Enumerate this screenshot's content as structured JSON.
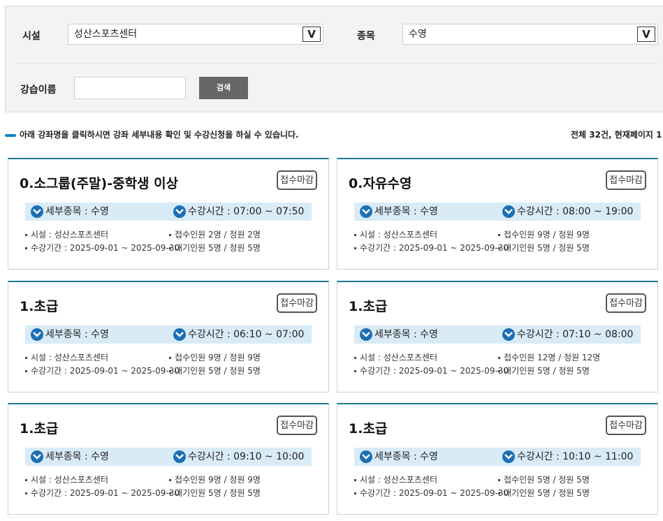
{
  "search": {
    "facility_label": "시설",
    "facility_value": "성산스포츠센터",
    "sport_label": "종목",
    "sport_value": "수영",
    "course_label": "강습이름",
    "course_value": "",
    "arrow_glyph": "V",
    "search_button": "검색"
  },
  "info": {
    "guide": "아래 강좌명을 클릭하시면 강좌 세부내용 확인 및 수강신청을 하실 수 있습니다.",
    "total": "전체 32건, 현재페이지 1"
  },
  "labels": {
    "sub_sport": "세부종목 : ",
    "time": "수강시간 : ",
    "facility": "시설 : ",
    "period": "수강기간 : "
  },
  "cards": [
    {
      "title": "0.소그룹(주말)-중학생 이상",
      "status": "접수마감",
      "sub_sport": "수영",
      "time": "07:00 ~ 07:50",
      "facility": "성산스포츠센터",
      "period": "2025-09-01 ~ 2025-09-30",
      "enrolled": "접수인원 2명 / 정원 2명",
      "waiting": "대기인원 5명 / 정원 5명"
    },
    {
      "title": "0.자유수영",
      "status": "접수마감",
      "sub_sport": "수영",
      "time": "08:00 ~ 19:00",
      "facility": "성산스포츠센터",
      "period": "2025-09-01 ~ 2025-09-30",
      "enrolled": "접수인원 9명 / 정원 9명",
      "waiting": "대기인원 5명 / 정원 5명"
    },
    {
      "title": "1.초급",
      "status": "접수마감",
      "sub_sport": "수영",
      "time": "06:10 ~ 07:00",
      "facility": "성산스포츠센터",
      "period": "2025-09-01 ~ 2025-09-30",
      "enrolled": "접수인원 9명 / 정원 9명",
      "waiting": "대기인원 5명 / 정원 5명"
    },
    {
      "title": "1.초급",
      "status": "접수마감",
      "sub_sport": "수영",
      "time": "07:10 ~ 08:00",
      "facility": "성산스포츠센터",
      "period": "2025-09-01 ~ 2025-09-30",
      "enrolled": "접수인원 12명 / 정원 12명",
      "waiting": "대기인원 5명 / 정원 5명"
    },
    {
      "title": "1.초급",
      "status": "접수마감",
      "sub_sport": "수영",
      "time": "09:10 ~ 10:00",
      "facility": "성산스포츠센터",
      "period": "2025-09-01 ~ 2025-09-30",
      "enrolled": "접수인원 9명 / 정원 9명",
      "waiting": "대기인원 5명 / 정원 5명"
    },
    {
      "title": "1.초급",
      "status": "접수마감",
      "sub_sport": "수영",
      "time": "10:10 ~ 11:00",
      "facility": "성산스포츠센터",
      "period": "2025-09-01 ~ 2025-09-30",
      "enrolled": "접수인원 5명 / 정원 5명",
      "waiting": "대기인원 5명 / 정원 5명"
    }
  ],
  "colors": {
    "accent": "#1d6fb5",
    "bar": "#d9ebf7",
    "card_top": "#1a7a8a",
    "button": "#666666"
  }
}
